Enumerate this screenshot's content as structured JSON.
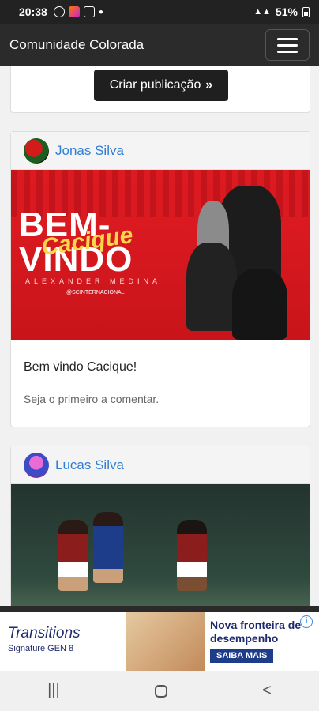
{
  "status_bar": {
    "time": "20:38",
    "battery": "51%"
  },
  "header": {
    "title": "Comunidade Colorada"
  },
  "create": {
    "label": "Criar publicação"
  },
  "posts": [
    {
      "author": "Jonas Silva",
      "image": {
        "headline_top": "BEM-",
        "headline_bottom": "VINDO",
        "script": "Cacique",
        "subtitle": "ALEXANDER MEDINA",
        "social_handle": "@SCINTERNACIONAL"
      },
      "text": "Bem vindo Cacique!",
      "comment_prompt": "Seja o primeiro a comentar."
    },
    {
      "author": "Lucas Silva"
    }
  ],
  "ad": {
    "brand": "Transitions",
    "brand_sub": "Signature GEN 8",
    "title": "Nova fronteira de desempenho",
    "cta": "SAIBA MAIS",
    "info": "i"
  },
  "colors": {
    "navbar": "#2b2b2b",
    "link": "#2e7ed6",
    "promo_red": "#e31c23"
  }
}
